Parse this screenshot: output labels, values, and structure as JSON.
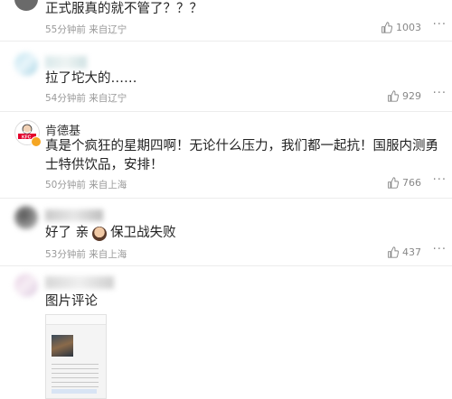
{
  "comments": [
    {
      "text": "正式服真的就不管了？？？",
      "meta": "55分钟前 来自辽宁",
      "likes": "1003"
    },
    {
      "text": "拉了坨大的……",
      "meta": "54分钟前 来自辽宁",
      "likes": "929"
    },
    {
      "username": "肯德基",
      "text": "真是个疯狂的星期四啊！无论什么压力，我们都一起抗！国服内测勇士特供饮品，安排！",
      "meta": "50分钟前 来自上海",
      "likes": "766"
    },
    {
      "text_a": "好了 亲",
      "text_b": "保卫战失败",
      "meta": "53分钟前 来自上海",
      "likes": "437"
    },
    {
      "text": "图片评论"
    }
  ],
  "icons": {
    "like": "thumbs-up-icon",
    "more": "more-dots-icon",
    "kfc_logo": "kfc-logo-icon"
  },
  "colors": {
    "meta_gray": "#999999",
    "kfc_red": "#e4002b",
    "verified_gold": "#f5a623"
  }
}
